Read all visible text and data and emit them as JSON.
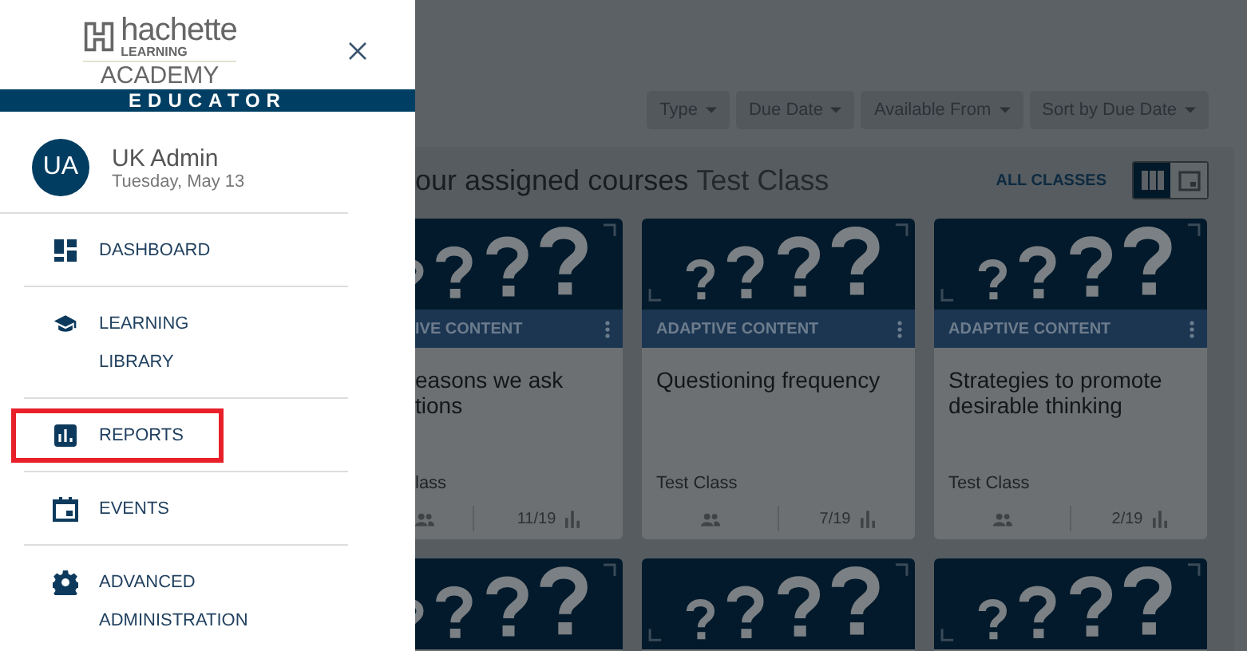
{
  "sidebar": {
    "logo": {
      "brand": "hachette",
      "sub": "LEARNING",
      "name": "ACADEMY"
    },
    "role": "EDUCATOR",
    "user": {
      "initials": "UA",
      "name": "UK Admin",
      "date": "Tuesday, May 13"
    },
    "items": [
      {
        "kind": "dashboard",
        "label": "DASHBOARD",
        "highlighted": false
      },
      {
        "kind": "cap",
        "label": "LEARNING",
        "sub": "LIBRARY",
        "highlighted": false
      },
      {
        "kind": "chart",
        "label": "REPORTS",
        "highlighted": true
      },
      {
        "kind": "calendar",
        "label": "EVENTS",
        "highlighted": false
      },
      {
        "kind": "gear",
        "label": "ADVANCED",
        "sub": "ADMINISTRATION",
        "highlighted": false
      }
    ]
  },
  "main": {
    "filters": [
      "Type",
      "Due Date",
      "Available From",
      "Sort by Due Date"
    ],
    "heading": {
      "title": "our assigned courses",
      "class_name": "Test Class"
    },
    "all_classes": "ALL CLASSES",
    "view_toggle": [
      {
        "kind": "grid",
        "selected": true
      },
      {
        "kind": "calendar",
        "selected": false
      }
    ],
    "cards": [
      {
        "kind": "course",
        "label": "IVE CONTENT",
        "title": "easons we ask\ntions",
        "class_name": "lass",
        "progress": "11/19"
      },
      {
        "kind": "course",
        "label": "ADAPTIVE CONTENT",
        "title": "Questioning frequency",
        "class_name": "Test Class",
        "progress": "7/19"
      },
      {
        "kind": "course",
        "label": "ADAPTIVE CONTENT",
        "title": "Strategies to promote desirable thinking",
        "class_name": "Test Class",
        "progress": "2/19"
      },
      {
        "kind": "picture"
      },
      {
        "kind": "picture"
      },
      {
        "kind": "picture"
      }
    ]
  }
}
